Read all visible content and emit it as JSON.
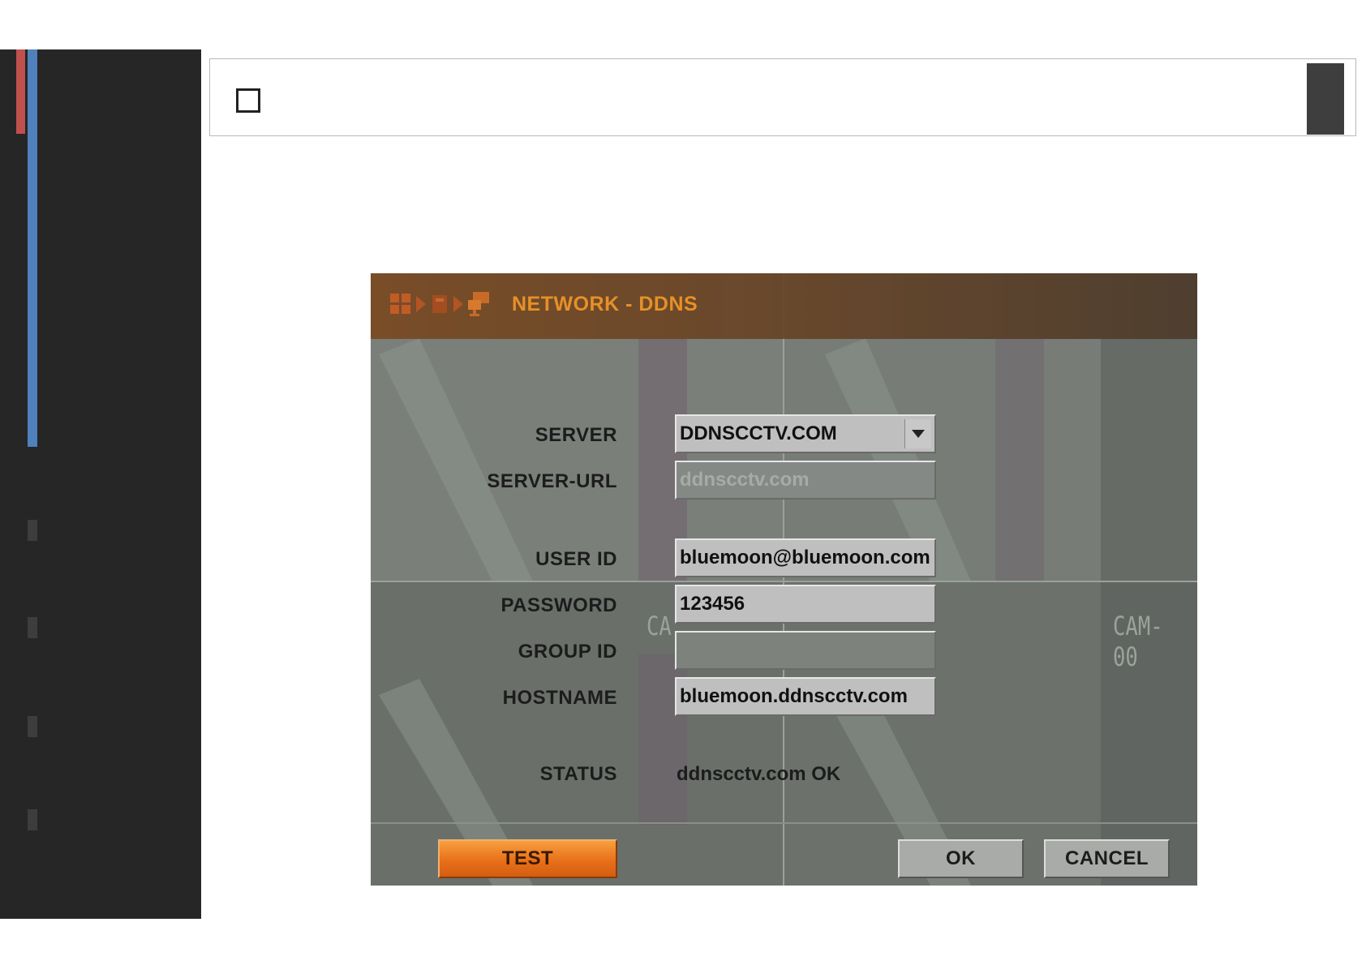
{
  "dialog": {
    "title": "NETWORK - DDNS",
    "cam_labels": [
      "CA",
      "CAM-00"
    ]
  },
  "form": {
    "server_label": "SERVER",
    "server_value": "DDNSCCTV.COM",
    "server_url_label": "SERVER-URL",
    "server_url_value": "ddnscctv.com",
    "user_id_label": "USER ID",
    "user_id_value": "bluemoon@bluemoon.com",
    "password_label": "PASSWORD",
    "password_value": "123456",
    "group_id_label": "GROUP ID",
    "group_id_value": "",
    "hostname_label": "HOSTNAME",
    "hostname_value": "bluemoon.ddnscctv.com",
    "status_label": "STATUS",
    "status_value": "ddnscctv.com OK"
  },
  "buttons": {
    "test": "TEST",
    "ok": "OK",
    "cancel": "CANCEL"
  },
  "colors": {
    "sidebar": "#262626",
    "accent_red": "#c0504d",
    "accent_blue": "#4f81bd",
    "title_orange": "#f29322",
    "test_button": "#e9701a"
  }
}
